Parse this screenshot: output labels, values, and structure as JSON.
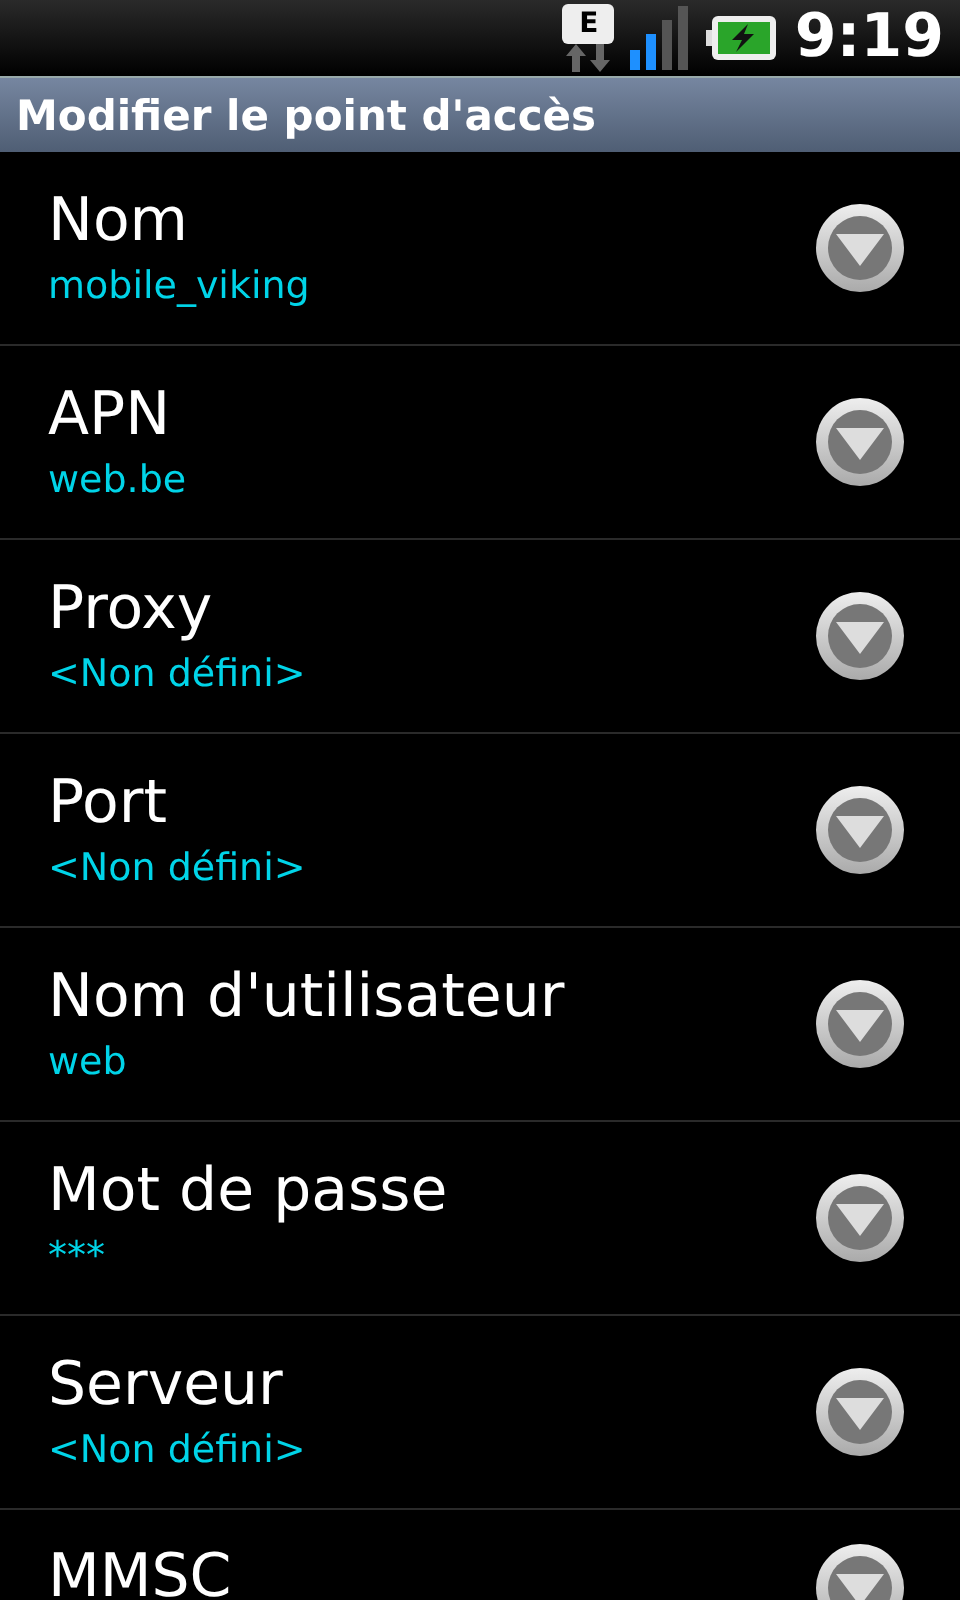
{
  "status_bar": {
    "network": "E",
    "time": "9:19"
  },
  "title": "Modifier le point d'accès",
  "items": [
    {
      "label": "Nom",
      "value": "mobile_viking"
    },
    {
      "label": "APN",
      "value": "web.be"
    },
    {
      "label": "Proxy",
      "value": "<Non défini>"
    },
    {
      "label": "Port",
      "value": "<Non défini>"
    },
    {
      "label": "Nom d'utilisateur",
      "value": "web"
    },
    {
      "label": "Mot de passe",
      "value": "***"
    },
    {
      "label": "Serveur",
      "value": "<Non défini>"
    },
    {
      "label": "MMSC"
    }
  ]
}
